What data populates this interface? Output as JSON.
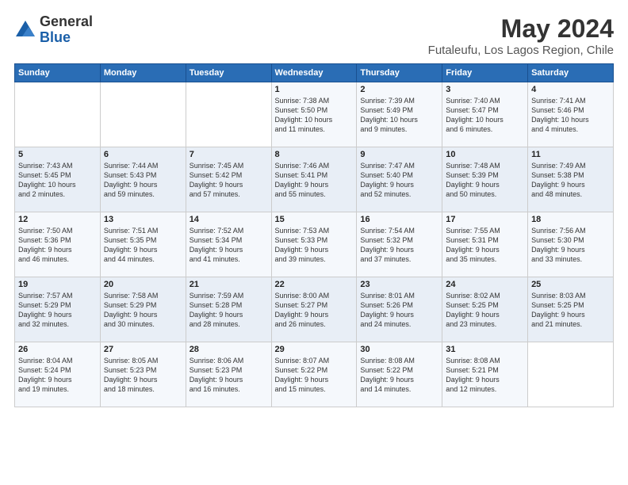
{
  "header": {
    "logo_general": "General",
    "logo_blue": "Blue",
    "month_year": "May 2024",
    "location": "Futaleufu, Los Lagos Region, Chile"
  },
  "days_of_week": [
    "Sunday",
    "Monday",
    "Tuesday",
    "Wednesday",
    "Thursday",
    "Friday",
    "Saturday"
  ],
  "weeks": [
    [
      {
        "day": "",
        "content": ""
      },
      {
        "day": "",
        "content": ""
      },
      {
        "day": "",
        "content": ""
      },
      {
        "day": "1",
        "content": "Sunrise: 7:38 AM\nSunset: 5:50 PM\nDaylight: 10 hours\nand 11 minutes."
      },
      {
        "day": "2",
        "content": "Sunrise: 7:39 AM\nSunset: 5:49 PM\nDaylight: 10 hours\nand 9 minutes."
      },
      {
        "day": "3",
        "content": "Sunrise: 7:40 AM\nSunset: 5:47 PM\nDaylight: 10 hours\nand 6 minutes."
      },
      {
        "day": "4",
        "content": "Sunrise: 7:41 AM\nSunset: 5:46 PM\nDaylight: 10 hours\nand 4 minutes."
      }
    ],
    [
      {
        "day": "5",
        "content": "Sunrise: 7:43 AM\nSunset: 5:45 PM\nDaylight: 10 hours\nand 2 minutes."
      },
      {
        "day": "6",
        "content": "Sunrise: 7:44 AM\nSunset: 5:43 PM\nDaylight: 9 hours\nand 59 minutes."
      },
      {
        "day": "7",
        "content": "Sunrise: 7:45 AM\nSunset: 5:42 PM\nDaylight: 9 hours\nand 57 minutes."
      },
      {
        "day": "8",
        "content": "Sunrise: 7:46 AM\nSunset: 5:41 PM\nDaylight: 9 hours\nand 55 minutes."
      },
      {
        "day": "9",
        "content": "Sunrise: 7:47 AM\nSunset: 5:40 PM\nDaylight: 9 hours\nand 52 minutes."
      },
      {
        "day": "10",
        "content": "Sunrise: 7:48 AM\nSunset: 5:39 PM\nDaylight: 9 hours\nand 50 minutes."
      },
      {
        "day": "11",
        "content": "Sunrise: 7:49 AM\nSunset: 5:38 PM\nDaylight: 9 hours\nand 48 minutes."
      }
    ],
    [
      {
        "day": "12",
        "content": "Sunrise: 7:50 AM\nSunset: 5:36 PM\nDaylight: 9 hours\nand 46 minutes."
      },
      {
        "day": "13",
        "content": "Sunrise: 7:51 AM\nSunset: 5:35 PM\nDaylight: 9 hours\nand 44 minutes."
      },
      {
        "day": "14",
        "content": "Sunrise: 7:52 AM\nSunset: 5:34 PM\nDaylight: 9 hours\nand 41 minutes."
      },
      {
        "day": "15",
        "content": "Sunrise: 7:53 AM\nSunset: 5:33 PM\nDaylight: 9 hours\nand 39 minutes."
      },
      {
        "day": "16",
        "content": "Sunrise: 7:54 AM\nSunset: 5:32 PM\nDaylight: 9 hours\nand 37 minutes."
      },
      {
        "day": "17",
        "content": "Sunrise: 7:55 AM\nSunset: 5:31 PM\nDaylight: 9 hours\nand 35 minutes."
      },
      {
        "day": "18",
        "content": "Sunrise: 7:56 AM\nSunset: 5:30 PM\nDaylight: 9 hours\nand 33 minutes."
      }
    ],
    [
      {
        "day": "19",
        "content": "Sunrise: 7:57 AM\nSunset: 5:29 PM\nDaylight: 9 hours\nand 32 minutes."
      },
      {
        "day": "20",
        "content": "Sunrise: 7:58 AM\nSunset: 5:29 PM\nDaylight: 9 hours\nand 30 minutes."
      },
      {
        "day": "21",
        "content": "Sunrise: 7:59 AM\nSunset: 5:28 PM\nDaylight: 9 hours\nand 28 minutes."
      },
      {
        "day": "22",
        "content": "Sunrise: 8:00 AM\nSunset: 5:27 PM\nDaylight: 9 hours\nand 26 minutes."
      },
      {
        "day": "23",
        "content": "Sunrise: 8:01 AM\nSunset: 5:26 PM\nDaylight: 9 hours\nand 24 minutes."
      },
      {
        "day": "24",
        "content": "Sunrise: 8:02 AM\nSunset: 5:25 PM\nDaylight: 9 hours\nand 23 minutes."
      },
      {
        "day": "25",
        "content": "Sunrise: 8:03 AM\nSunset: 5:25 PM\nDaylight: 9 hours\nand 21 minutes."
      }
    ],
    [
      {
        "day": "26",
        "content": "Sunrise: 8:04 AM\nSunset: 5:24 PM\nDaylight: 9 hours\nand 19 minutes."
      },
      {
        "day": "27",
        "content": "Sunrise: 8:05 AM\nSunset: 5:23 PM\nDaylight: 9 hours\nand 18 minutes."
      },
      {
        "day": "28",
        "content": "Sunrise: 8:06 AM\nSunset: 5:23 PM\nDaylight: 9 hours\nand 16 minutes."
      },
      {
        "day": "29",
        "content": "Sunrise: 8:07 AM\nSunset: 5:22 PM\nDaylight: 9 hours\nand 15 minutes."
      },
      {
        "day": "30",
        "content": "Sunrise: 8:08 AM\nSunset: 5:22 PM\nDaylight: 9 hours\nand 14 minutes."
      },
      {
        "day": "31",
        "content": "Sunrise: 8:08 AM\nSunset: 5:21 PM\nDaylight: 9 hours\nand 12 minutes."
      },
      {
        "day": "",
        "content": ""
      }
    ]
  ]
}
